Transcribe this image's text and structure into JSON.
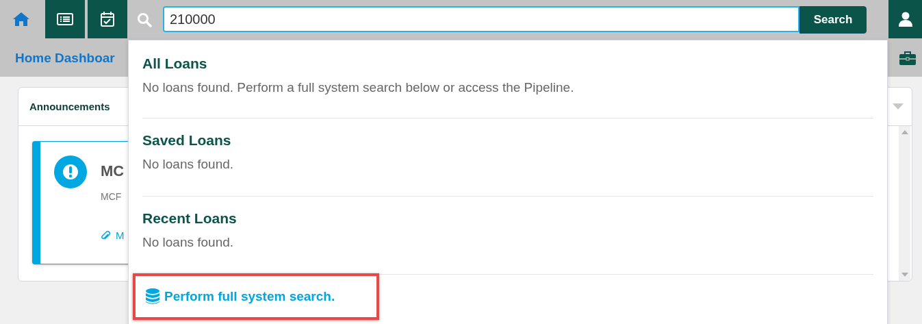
{
  "nav": [
    {
      "kind": "home",
      "selected": true
    },
    {
      "kind": "list",
      "selected": false
    },
    {
      "kind": "calendar",
      "selected": false
    }
  ],
  "search": {
    "value": "210000",
    "button": "Search"
  },
  "breadcrumb": "Home Dashboar",
  "panel": {
    "title": "Announcements",
    "item": {
      "title": "MC",
      "body": "MCF",
      "link": "M"
    }
  },
  "dropdown": {
    "sections": [
      {
        "title": "All Loans",
        "message": "No loans found. Perform a full system search below or access the Pipeline."
      },
      {
        "title": "Saved Loans",
        "message": "No loans found."
      },
      {
        "title": "Recent Loans",
        "message": "No loans found."
      }
    ],
    "action": {
      "label": "Perform full system search.",
      "highlighted": true
    }
  }
}
